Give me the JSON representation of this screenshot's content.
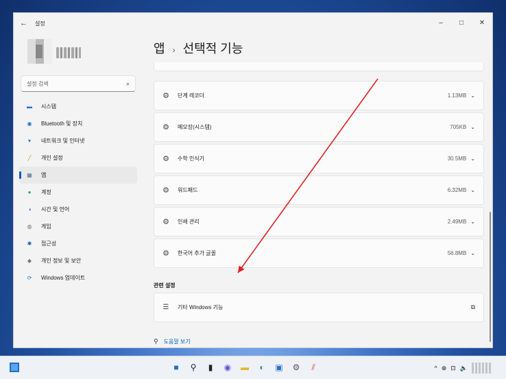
{
  "window": {
    "title": "설정",
    "back_glyph": "←",
    "controls": {
      "minimize": "–",
      "maximize": "□",
      "close": "✕"
    }
  },
  "profile": {
    "avatar_icon": "avatar-icon"
  },
  "search": {
    "placeholder": "설정 검색",
    "icon": "⌕"
  },
  "sidebar": {
    "items": [
      {
        "label": "시스템",
        "icon": "▬",
        "color": "#2d6bd6"
      },
      {
        "label": "Bluetooth 및 장치",
        "icon": "◉",
        "color": "#1a73c9"
      },
      {
        "label": "네트워크 및 인터넷",
        "icon": "▾",
        "color": "#2d6bd6"
      },
      {
        "label": "개인 설정",
        "icon": "╱",
        "color": "#c98a2a"
      },
      {
        "label": "앱",
        "icon": "▦",
        "color": "#5a6c85"
      },
      {
        "label": "계정",
        "icon": "●",
        "color": "#2faa5a"
      },
      {
        "label": "시간 및 언어",
        "icon": "◑",
        "color": "#2d6bd6"
      },
      {
        "label": "게임",
        "icon": "◍",
        "color": "#777777"
      },
      {
        "label": "접근성",
        "icon": "✱",
        "color": "#1a5bb8"
      },
      {
        "label": "개인 정보 및 보안",
        "icon": "◆",
        "color": "#777777"
      },
      {
        "label": "Windows 업데이트",
        "icon": "⟳",
        "color": "#1a73c9"
      }
    ],
    "active_index": 4
  },
  "page": {
    "breadcrumb_parent": "앱",
    "separator": "›",
    "title": "선택적 기능"
  },
  "features": [
    {
      "name": "단계 레코더",
      "size": "1.13MB"
    },
    {
      "name": "메모장(시스템)",
      "size": "705KB"
    },
    {
      "name": "수학 인식기",
      "size": "30.5MB"
    },
    {
      "name": "워드패드",
      "size": "6.32MB"
    },
    {
      "name": "인쇄 관리",
      "size": "2.49MB"
    },
    {
      "name": "한국어 추가 글꼴",
      "size": "56.8MB"
    }
  ],
  "related": {
    "heading": "관련 설정",
    "item_label": "기타 Windows 기능",
    "item_icon": "☰",
    "external_icon": "⧉"
  },
  "help": {
    "label": "도움말 보기",
    "icon": "⚲"
  },
  "feature_icon": "⚙",
  "chevron": "⌄",
  "taskbar": {
    "apps": [
      "start-icon",
      "search-icon",
      "taskview-icon",
      "chat-icon",
      "file-explorer-icon",
      "edge-icon",
      "store-icon",
      "settings-icon",
      "paint-icon"
    ],
    "tray": [
      "^",
      "⊗",
      "⊡",
      "🔈"
    ]
  },
  "annotation_color": "#e02020"
}
